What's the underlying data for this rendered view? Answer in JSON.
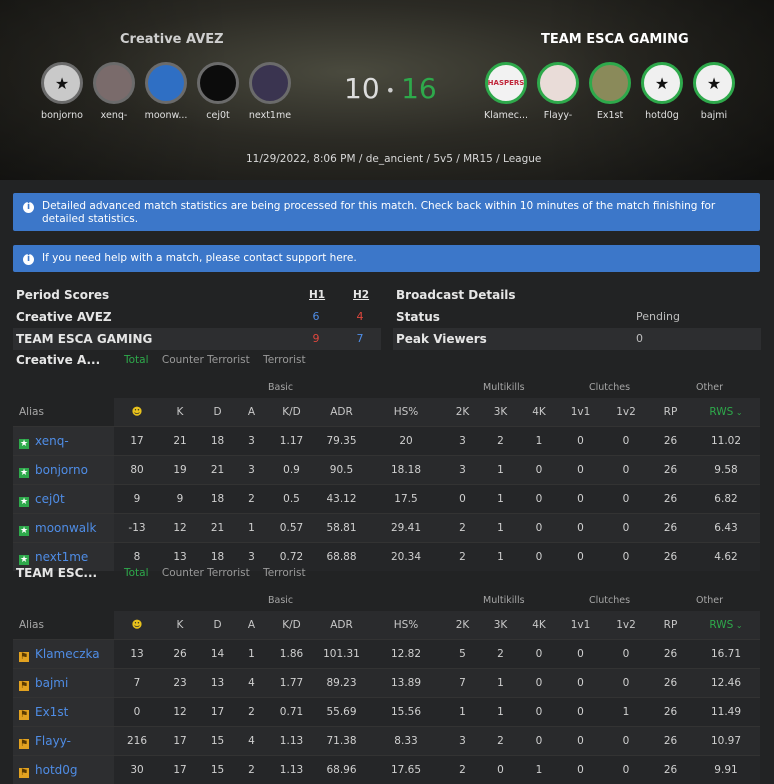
{
  "header": {
    "team1": {
      "name": "Creative AVEZ",
      "players": [
        {
          "name": "bonjorno",
          "avatar_icon": "star-logo-icon"
        },
        {
          "name": "xenq-",
          "avatar_icon": "anime-avatar-icon"
        },
        {
          "name": "moonw...",
          "avatar_icon": "sonic-avatar-icon"
        },
        {
          "name": "cej0t",
          "avatar_icon": "black-avatar-icon"
        },
        {
          "name": "next1me",
          "avatar_icon": "anime-avatar-icon"
        }
      ]
    },
    "team2": {
      "name": "TEAM ESCA GAMING",
      "players": [
        {
          "name": "Klamec...",
          "avatar_icon": "hasper-logo-icon",
          "avatar_text": "HASPERS"
        },
        {
          "name": "Flayy-",
          "avatar_icon": "anime-avatar-icon"
        },
        {
          "name": "Ex1st",
          "avatar_icon": "yoda-avatar-icon"
        },
        {
          "name": "hotd0g",
          "avatar_icon": "star-logo-icon"
        },
        {
          "name": "bajmi",
          "avatar_icon": "star-logo-icon"
        }
      ]
    },
    "score1": "10",
    "separator": "•",
    "score2": "16",
    "match_info": "11/29/2022, 8:06 PM / de_ancient / 5v5 / MR15 / League"
  },
  "alerts": {
    "processing": "Detailed advanced match statistics are being processed for this match. Check back within 10 minutes of the match finishing for detailed statistics.",
    "help_prefix": "If you need help with a match, please contact support ",
    "help_link": "here",
    "help_suffix": "."
  },
  "period_scores": {
    "title": "Period Scores",
    "h1_label": "H1",
    "h2_label": "H2",
    "rows": [
      {
        "team": "Creative AVEZ",
        "h1": "6",
        "h2": "4"
      },
      {
        "team": "TEAM ESCA GAMING",
        "h1": "9",
        "h2": "7"
      }
    ]
  },
  "broadcast": {
    "title": "Broadcast Details",
    "status_label": "Status",
    "status_value": "Pending",
    "viewers_label": "Peak Viewers",
    "viewers_value": "0"
  },
  "tabs": [
    "Total",
    "Counter Terrorist",
    "Terrorist"
  ],
  "groups": {
    "basic": "Basic",
    "multikills": "Multikills",
    "clutches": "Clutches",
    "other": "Other"
  },
  "columns": {
    "alias": "Alias",
    "smiley": "☻",
    "k": "K",
    "d": "D",
    "a": "A",
    "kd": "K/D",
    "adr": "ADR",
    "hs": "HS%",
    "k2": "2K",
    "k3": "3K",
    "k4": "4K",
    "c1v1": "1v1",
    "c1v2": "1v2",
    "rp": "RP",
    "rws": "RWS"
  },
  "colors": {
    "accent_green": "#2ea94b",
    "info_blue": "#3c77c9",
    "link_blue": "#4f8de6",
    "red": "#e0473d"
  },
  "team1_table": {
    "title": "Creative A...",
    "rows": [
      [
        "xenq-",
        "17",
        "21",
        "18",
        "3",
        "1.17",
        "79.35",
        "20",
        "3",
        "2",
        "1",
        "0",
        "0",
        "26",
        "11.02"
      ],
      [
        "bonjorno",
        "80",
        "19",
        "21",
        "3",
        "0.9",
        "90.5",
        "18.18",
        "3",
        "1",
        "0",
        "0",
        "0",
        "26",
        "9.58"
      ],
      [
        "cej0t",
        "9",
        "9",
        "18",
        "2",
        "0.5",
        "43.12",
        "17.5",
        "0",
        "1",
        "0",
        "0",
        "0",
        "26",
        "6.82"
      ],
      [
        "moonwalk",
        "-13",
        "12",
        "21",
        "1",
        "0.57",
        "58.81",
        "29.41",
        "2",
        "1",
        "0",
        "0",
        "0",
        "26",
        "6.43"
      ],
      [
        "next1me",
        "8",
        "13",
        "18",
        "3",
        "0.72",
        "68.88",
        "20.34",
        "2",
        "1",
        "0",
        "0",
        "0",
        "26",
        "4.62"
      ]
    ]
  },
  "team2_table": {
    "title": "TEAM ESC...",
    "rows": [
      [
        "Klameczka",
        "13",
        "26",
        "14",
        "1",
        "1.86",
        "101.31",
        "12.82",
        "5",
        "2",
        "0",
        "0",
        "0",
        "26",
        "16.71"
      ],
      [
        "bajmi",
        "7",
        "23",
        "13",
        "4",
        "1.77",
        "89.23",
        "13.89",
        "7",
        "1",
        "0",
        "0",
        "0",
        "26",
        "12.46"
      ],
      [
        "Ex1st",
        "0",
        "12",
        "17",
        "2",
        "0.71",
        "55.69",
        "15.56",
        "1",
        "1",
        "0",
        "0",
        "1",
        "26",
        "11.49"
      ],
      [
        "Flayy-",
        "216",
        "17",
        "15",
        "4",
        "1.13",
        "71.38",
        "8.33",
        "3",
        "2",
        "0",
        "0",
        "0",
        "26",
        "10.97"
      ],
      [
        "hotd0g",
        "30",
        "17",
        "15",
        "2",
        "1.13",
        "68.96",
        "17.65",
        "2",
        "0",
        "1",
        "0",
        "0",
        "26",
        "9.91"
      ]
    ]
  }
}
